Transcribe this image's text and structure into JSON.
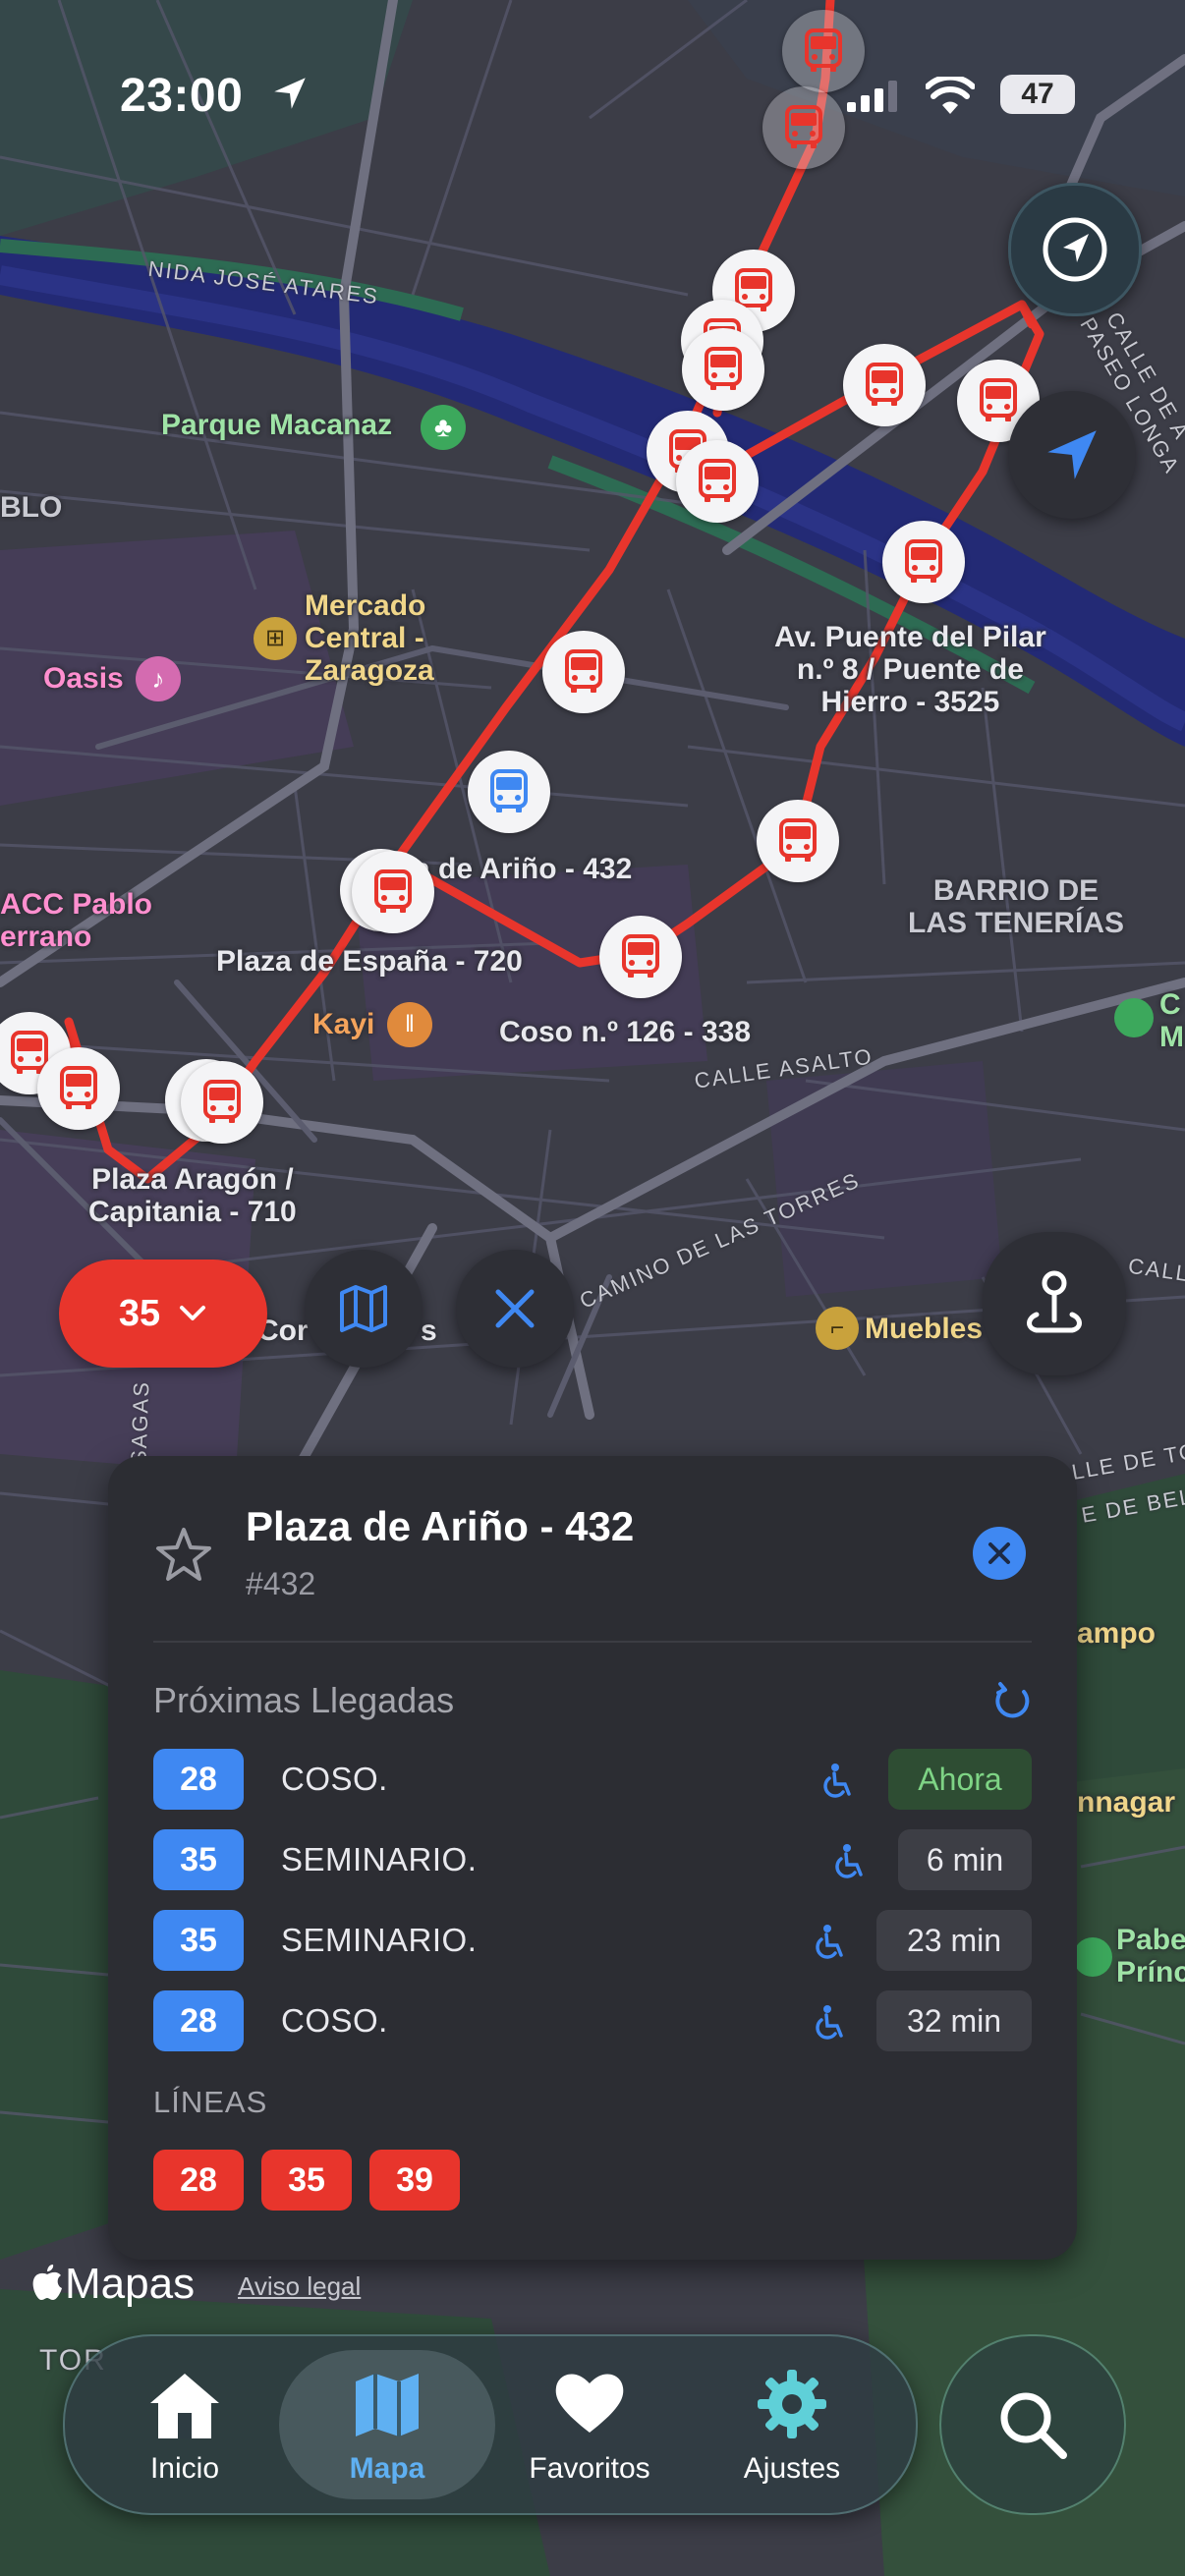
{
  "status_bar": {
    "time": "23:00",
    "battery": "47"
  },
  "map": {
    "street_labels": [
      "NIDA JOSÉ ATARES",
      "CALLE ASALTO",
      "CAMINO DE LAS TORRES",
      "CALLE DE A",
      "PASEO LONGA",
      "CALL",
      "LLE DE TO",
      "E DE BEL",
      "SAGAS",
      "TOR",
      "BLO"
    ],
    "poi_labels": {
      "parque": "Parque Macanaz",
      "mercado": [
        "Mercado",
        "Central -",
        "Zaragoza"
      ],
      "oasis": "Oasis",
      "acc": [
        "ACC Pablo",
        "errano"
      ],
      "kayi": "Kayi",
      "muebles": "Muebles",
      "corte": "Cor",
      "corte_end": "s",
      "barrio": [
        "BARRIO DE",
        "LAS TENERÍAS"
      ],
      "ampo": "ampo",
      "nnagar": "nnagar",
      "pabe": [
        "Pabe",
        "Prínc"
      ],
      "cm": [
        "C",
        "M"
      ]
    },
    "stop_labels": {
      "puente": [
        "Av. Puente del Pilar",
        "n.º 8 / Puente de",
        "Hierro - 3525"
      ],
      "arino": "za de Ariño - 432",
      "arino_prefix": "P",
      "espana": "Plaza de España - 720",
      "coso": "Coso n.º 126 - 338",
      "aragon": [
        "Plaza Aragón /",
        "Capitania - 710"
      ]
    },
    "route_color": "#e8352c",
    "selected_stop_color": "#3f88f2"
  },
  "controls": {
    "line_selector": "35",
    "map_button_icon": "map-icon",
    "close_button_icon": "close-icon",
    "pin_button_icon": "pin-icon",
    "compass_icon": "compass-icon",
    "location_icon": "location-arrow-icon"
  },
  "stop_card": {
    "title": "Plaza de Ariño - 432",
    "subtitle": "#432",
    "arrivals_title": "Próximas Llegadas",
    "arrivals": [
      {
        "line": "28",
        "destination": "COSO.",
        "time": "Ahora"
      },
      {
        "line": "35",
        "destination": "SEMINARIO.",
        "time": "6 min"
      },
      {
        "line": "35",
        "destination": "SEMINARIO.",
        "time": "23 min"
      },
      {
        "line": "28",
        "destination": "COSO.",
        "time": "32 min"
      }
    ],
    "lines_title": "LÍNEAS",
    "lines": [
      "28",
      "35",
      "39"
    ]
  },
  "footer": {
    "brand": "Mapas",
    "legal": "Aviso legal"
  },
  "tab_bar": {
    "tabs": [
      {
        "label": "Inicio",
        "icon": "home-icon"
      },
      {
        "label": "Mapa",
        "icon": "map-icon"
      },
      {
        "label": "Favoritos",
        "icon": "heart-icon"
      },
      {
        "label": "Ajustes",
        "icon": "gear-icon"
      }
    ],
    "active": "Mapa",
    "search_icon": "search-icon"
  },
  "colors": {
    "accent_red": "#e8352c",
    "accent_blue": "#3f88f2",
    "now_green": "#7ed485",
    "active_tab": "#5fb0f2"
  }
}
